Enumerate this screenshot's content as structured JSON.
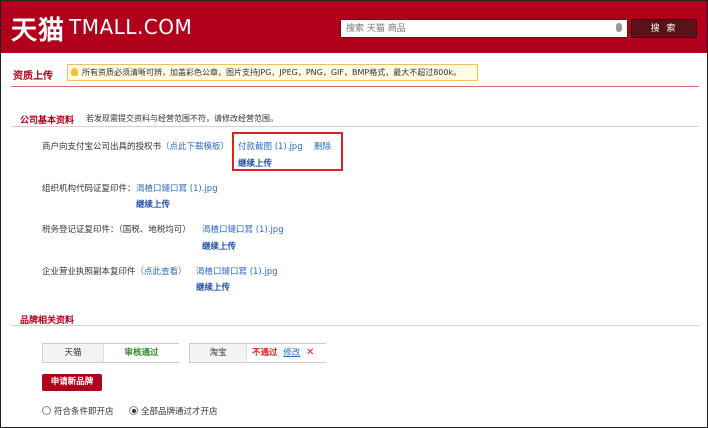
{
  "header": {
    "logo_cn": "天猫",
    "logo_en": "TMALL.COM",
    "search_placeholder": "搜索 天猫 商品",
    "search_button": "搜 索",
    "brand_color": "#b0001c"
  },
  "page": {
    "title": "资质上传",
    "tip": "所有资质必须清晰可辨，加盖彩色公章，图片支持JPG，JPEG，PNG，GIF，BMP格式，最大不超过800k。"
  },
  "company_section": {
    "title": "公司基本资料",
    "note": "若发现需提交资料与经营范围不符，请修改经营范围。",
    "items": [
      {
        "label": "商户向支付宝公司出具的授权书",
        "link": "（点此下载模板）",
        "file": "付款截图 (1).jpg",
        "delete": "删除",
        "continue": "继续上传"
      },
      {
        "label": "组织机构代码证复印件：",
        "link": "",
        "file": "渴楂口鏈口冩 (1).jpg",
        "continue": "继续上传"
      },
      {
        "label": "税务登记证复印件：（国税、地税均可）",
        "link": "",
        "file": "渴楂口鏈口冩 (1).jpg",
        "continue": "继续上传"
      },
      {
        "label": "企业营业执照副本复印件",
        "link": "（点此查看）",
        "file": "渴楂口鏈口冩 (1).jpg",
        "continue": "继续上传"
      }
    ]
  },
  "brand_section": {
    "title": "品牌相关资料",
    "brands": [
      {
        "name": "天猫",
        "status": "审核通过",
        "status_color": "#2d8a2d"
      },
      {
        "name": "淘宝",
        "status": "不通过",
        "status_color": "#e02020",
        "edit": "修改",
        "remove_icon": "close-icon"
      }
    ],
    "apply_button": "申请新品牌",
    "radio_options": [
      {
        "label": "符合条件即开店",
        "selected": false
      },
      {
        "label": "全部品牌通过才开店",
        "selected": true
      }
    ]
  }
}
